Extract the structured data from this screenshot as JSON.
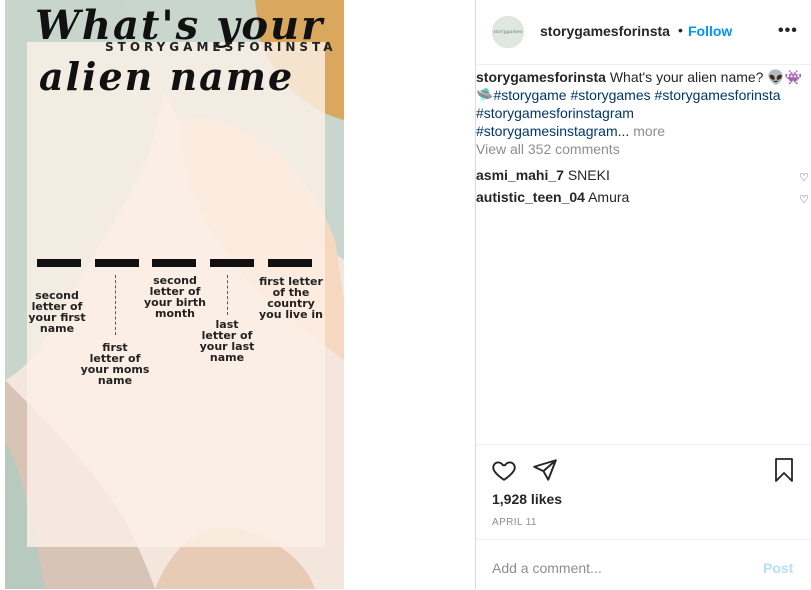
{
  "story_image": {
    "title_line1": "What's your",
    "title_line2": "alien name",
    "watermark": "STORYGAMESFORINSTA",
    "hints": [
      "second\nletter of\nyour first\nname",
      "first\nletter of\nyour moms\nname",
      "second\nletter of\nyour birth\nmonth",
      "last\nletter of\nyour last\nname",
      "first letter\nof the\ncountry\nyou live in"
    ]
  },
  "header": {
    "avatar_text": "storygames",
    "username": "storygamesforinsta",
    "separator": "•",
    "follow_label": "Follow",
    "more_icon": "•••"
  },
  "caption": {
    "username": "storygamesforinsta",
    "text": "What's your alien name?",
    "emoji": "👽👾",
    "ufo_emoji": "🛸",
    "tags": [
      "#storygame",
      "#storygames",
      "#storygamesforinsta",
      "#storygamesforinstagram",
      "#storygamesinstagram..."
    ],
    "more_label": "more"
  },
  "view_comments": "View all 352 comments",
  "comments": [
    {
      "username": "asmi_mahi_7",
      "text": "SNEKI"
    },
    {
      "username": "autistic_teen_04",
      "text": "Amura"
    }
  ],
  "actions": {
    "icons": [
      "heart-icon",
      "share-icon",
      "bookmark-icon"
    ],
    "likes": "1,928 likes",
    "date": "APRIL 11"
  },
  "comment_box": {
    "placeholder": "Add a comment...",
    "post_label": "Post"
  },
  "colors": {
    "link_blue": "#0095f6",
    "hashtag_blue": "#00376b",
    "muted_gray": "#8e8e8e",
    "post_disabled": "#b2dffc",
    "border": "#dbdbdb"
  }
}
